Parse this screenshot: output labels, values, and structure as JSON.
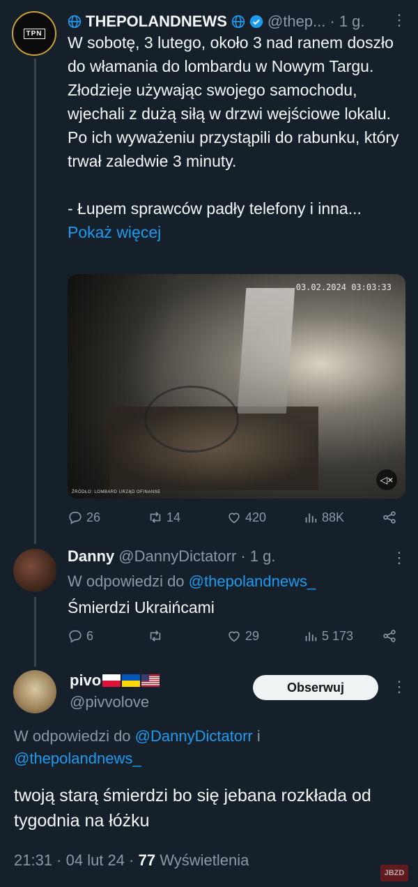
{
  "colors": {
    "background": "#15202b",
    "accent": "#1d9bf0",
    "muted": "#8b98a5",
    "text": "#f7f9f9"
  },
  "tweet1": {
    "avatar_text": "TPN",
    "author": "THEPOLANDNEWS",
    "handle": "@thep...",
    "dot_time": "· 1 g.",
    "paragraph1": "W sobotę, 3 lutego, około 3 nad ranem doszło do włamania do lombardu w Nowym Targu. Złodzieje używając swojego samochodu, wjechali z dużą siłą w drzwi wejściowe lokalu. Po ich wyważeniu przystąpili do rabunku, który trwał zaledwie 3 minuty.",
    "paragraph2": "- Łupem sprawców padły telefony i inna...",
    "show_more": "Pokaż więcej",
    "video_timestamp": "03.02.2024 03:03:33",
    "video_watermark": "ŹRÓDŁO: LOMBARD URZĄD OFINANSE",
    "stats": {
      "replies": "26",
      "retweets": "14",
      "likes": "420",
      "views": "88K"
    }
  },
  "tweet2": {
    "author": "Danny",
    "handle": "@DannyDictatorr",
    "dot_time": "· 1 g.",
    "reply_prefix": "W odpowiedzi do",
    "reply_target": "@thepolandnews_",
    "text": "Śmierdzi Ukraińcami",
    "stats": {
      "replies": "6",
      "retweets": "",
      "likes": "29",
      "views": "5 173"
    }
  },
  "tweet3": {
    "author": "pivo",
    "handle": "@pivvolove",
    "follow_label": "Obserwuj",
    "reply_prefix": "W odpowiedzi do",
    "reply_target1": "@DannyDictatorr",
    "reply_and": "i",
    "reply_target2": "@thepolandnews_",
    "text": "twoją starą śmierdzi bo się jebana rozkłada od tygodnia na łóżku",
    "time": "21:31 · 04 lut 24 ·",
    "views_count": "77",
    "views_label": "Wyświetlenia"
  },
  "watermark": "JBZD",
  "icons": [
    "globe-icon",
    "verified-badge-icon",
    "more-icon",
    "reply-icon",
    "retweet-icon",
    "like-icon",
    "views-icon",
    "share-icon",
    "mute-icon",
    "flag-poland-icon",
    "flag-ukraine-icon",
    "flag-usa-icon"
  ]
}
